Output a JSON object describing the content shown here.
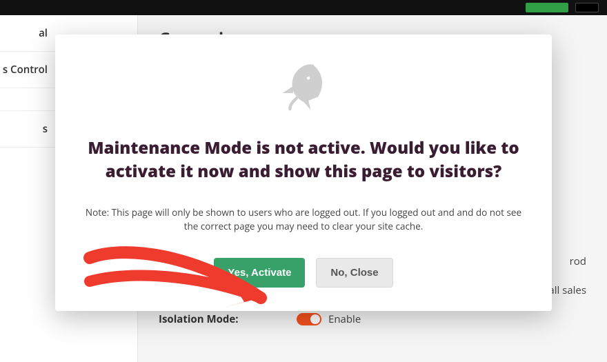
{
  "sidebar": {
    "items": [
      {
        "label": "al"
      },
      {
        "label": "s Control"
      },
      {
        "label": ""
      },
      {
        "label": "s"
      }
    ]
  },
  "content": {
    "heading": "General",
    "page_row_label": "",
    "page_row_value": "rod",
    "note_value": "on all sales",
    "isolation_label": "Isolation Mode:",
    "isolation_value": "Enable"
  },
  "dialog": {
    "title": "Maintenance Mode is not active. Would you like to activate it now and show this page to visitors?",
    "note": "Note: This page will only be shown to users who are logged out. If you logged out and and do not see the correct page you may need to clear your site cache.",
    "yes_label": "Yes, Activate",
    "no_label": "No, Close"
  },
  "icons": {
    "rocket": "rocket-icon"
  },
  "annotation": {
    "type": "arrow",
    "target": "yes-activate-button"
  }
}
